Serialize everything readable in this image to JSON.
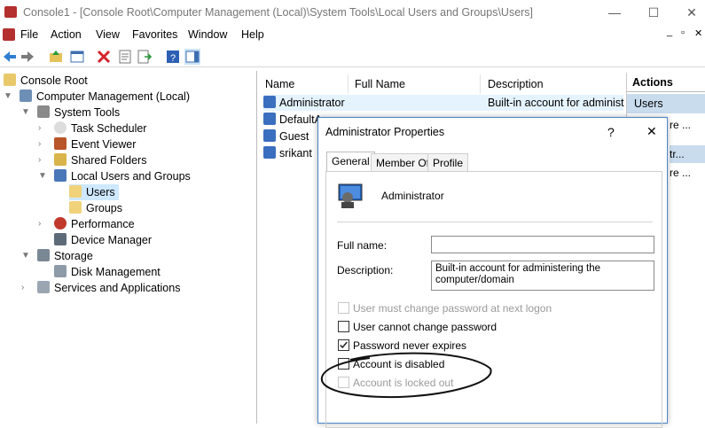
{
  "window": {
    "title": "Console1 - [Console Root\\Computer Management (Local)\\System Tools\\Local Users and Groups\\Users]",
    "minimize": "—",
    "maximize": "☐",
    "close": "✕"
  },
  "menu": [
    "File",
    "Action",
    "View",
    "Favorites",
    "Window",
    "Help"
  ],
  "mdi": {
    "min": "_",
    "restore": "▫",
    "close": "✕"
  },
  "tree": [
    "Console Root",
    "Computer Management (Local)",
    "System Tools",
    "Task Scheduler",
    "Event Viewer",
    "Shared Folders",
    "Local Users and Groups",
    "Users",
    "Groups",
    "Performance",
    "Device Manager",
    "Storage",
    "Disk Management",
    "Services and Applications"
  ],
  "list": {
    "columns": [
      "Name",
      "Full Name",
      "Description"
    ],
    "rows": [
      {
        "name": "Administrator",
        "full": "",
        "desc": "Built-in account for administ"
      },
      {
        "name": "DefaultA",
        "full": "",
        "desc": ""
      },
      {
        "name": "Guest",
        "full": "",
        "desc": ""
      },
      {
        "name": "srikant",
        "full": "",
        "desc": ""
      }
    ]
  },
  "actions": {
    "header": "Actions",
    "item": "Users",
    "more1": "re ...",
    "more2": "tr...",
    "more3": "re ..."
  },
  "dialog": {
    "title": "Administrator Properties",
    "help": "?",
    "close": "✕",
    "tabs": [
      "General",
      "Member Of",
      "Profile"
    ],
    "username": "Administrator",
    "fullname_label": "Full name:",
    "fullname_value": "",
    "desc_label": "Description:",
    "desc_value": "Built-in account for administering the computer/domain",
    "checks": [
      {
        "label": "User must change password at next logon",
        "checked": false,
        "disabled": true
      },
      {
        "label": "User cannot change password",
        "checked": false,
        "disabled": false
      },
      {
        "label": "Password never expires",
        "checked": true,
        "disabled": false
      },
      {
        "label": "Account is disabled",
        "checked": false,
        "disabled": false
      },
      {
        "label": "Account is locked out",
        "checked": false,
        "disabled": true
      }
    ]
  }
}
